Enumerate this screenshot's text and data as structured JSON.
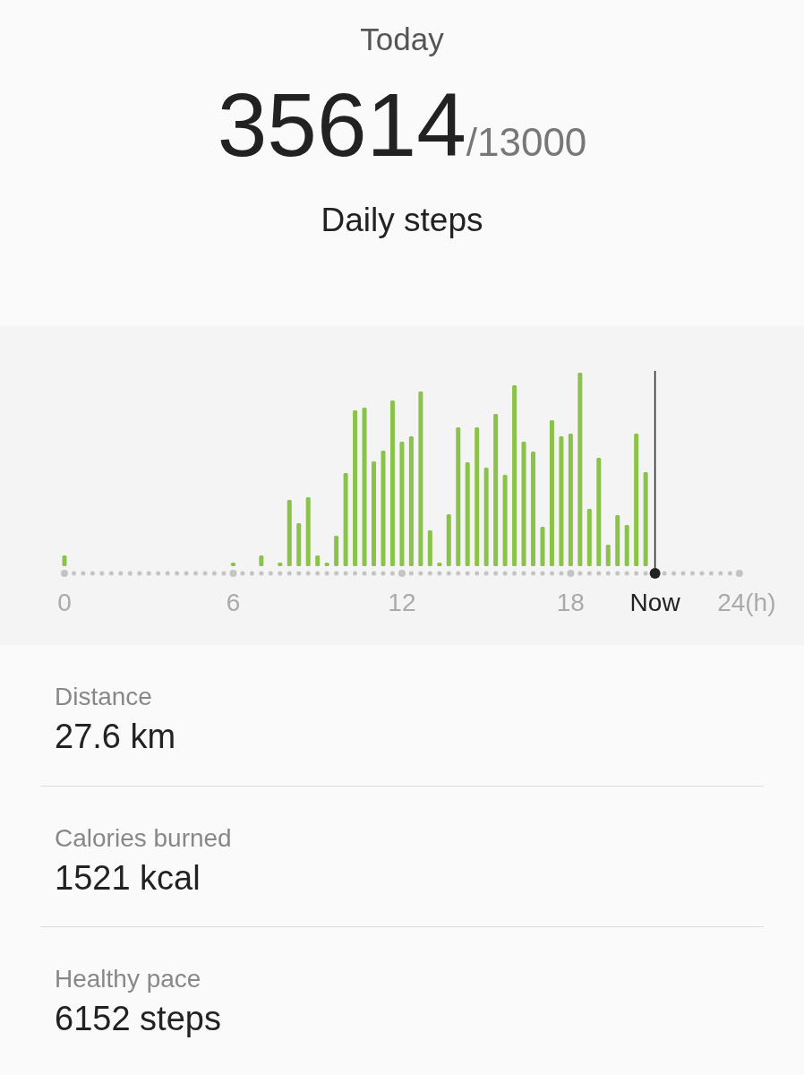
{
  "header": {
    "title": "Today",
    "steps": "35614",
    "goal": "/13000",
    "caption": "Daily steps"
  },
  "chart": {
    "axis_labels": [
      {
        "label": "0",
        "current": false
      },
      {
        "label": "6",
        "current": false
      },
      {
        "label": "12",
        "current": false
      },
      {
        "label": "18",
        "current": false
      },
      {
        "label": "Now",
        "current": true
      },
      {
        "label": "24(h)",
        "current": false
      }
    ]
  },
  "stats": [
    {
      "label": "Distance",
      "value": "27.6 km"
    },
    {
      "label": "Calories burned",
      "value": "1521 kcal"
    },
    {
      "label": "Healthy pace",
      "value": "6152 steps"
    }
  ]
}
